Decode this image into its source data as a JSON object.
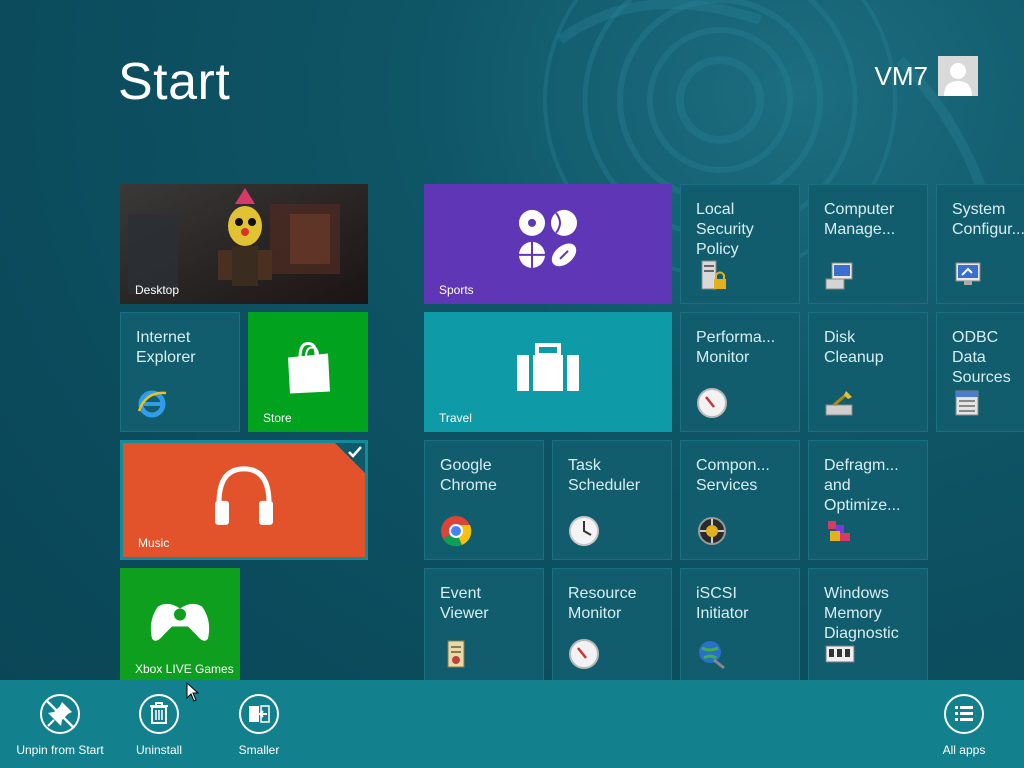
{
  "header": {
    "title": "Start",
    "user_name": "VM7"
  },
  "tiles": {
    "desktop": {
      "label": "Desktop"
    },
    "ie": {
      "title": "Internet\nExplorer"
    },
    "store": {
      "label": "Store",
      "color": "#00a21e"
    },
    "music": {
      "label": "Music",
      "color": "#e2522b",
      "selected": true
    },
    "xbox": {
      "label": "Xbox LIVE Games",
      "color": "#0e9f1e"
    },
    "sports": {
      "label": "Sports",
      "color": "#5f36b6"
    },
    "travel": {
      "label": "Travel",
      "color": "#0e9aa7"
    },
    "chrome": {
      "title": "Google\nChrome"
    },
    "task_scheduler": {
      "title": "Task\nScheduler"
    },
    "event_viewer": {
      "title": "Event\nViewer"
    },
    "resource_monitor": {
      "title": "Resource\nMonitor"
    },
    "local_security": {
      "title": "Local\nSecurity\nPolicy"
    },
    "perf_monitor": {
      "title": "Performa...\nMonitor"
    },
    "component_services": {
      "title": "Compon...\nServices"
    },
    "iscsi": {
      "title": "iSCSI\nInitiator"
    },
    "computer_management": {
      "title": "Computer\nManage..."
    },
    "disk_cleanup": {
      "title": "Disk\nCleanup"
    },
    "defrag": {
      "title": "Defragm...\nand\nOptimize..."
    },
    "memory_diag": {
      "title": "Windows\nMemory\nDiagnostic"
    },
    "system_config": {
      "title": "System\nConfigur..."
    },
    "odbc": {
      "title": "ODBC\nData\nSources"
    }
  },
  "appbar": {
    "unpin_label": "Unpin from Start",
    "uninstall_label": "Uninstall",
    "smaller_label": "Smaller",
    "all_apps_label": "All apps",
    "color": "#13808e"
  }
}
